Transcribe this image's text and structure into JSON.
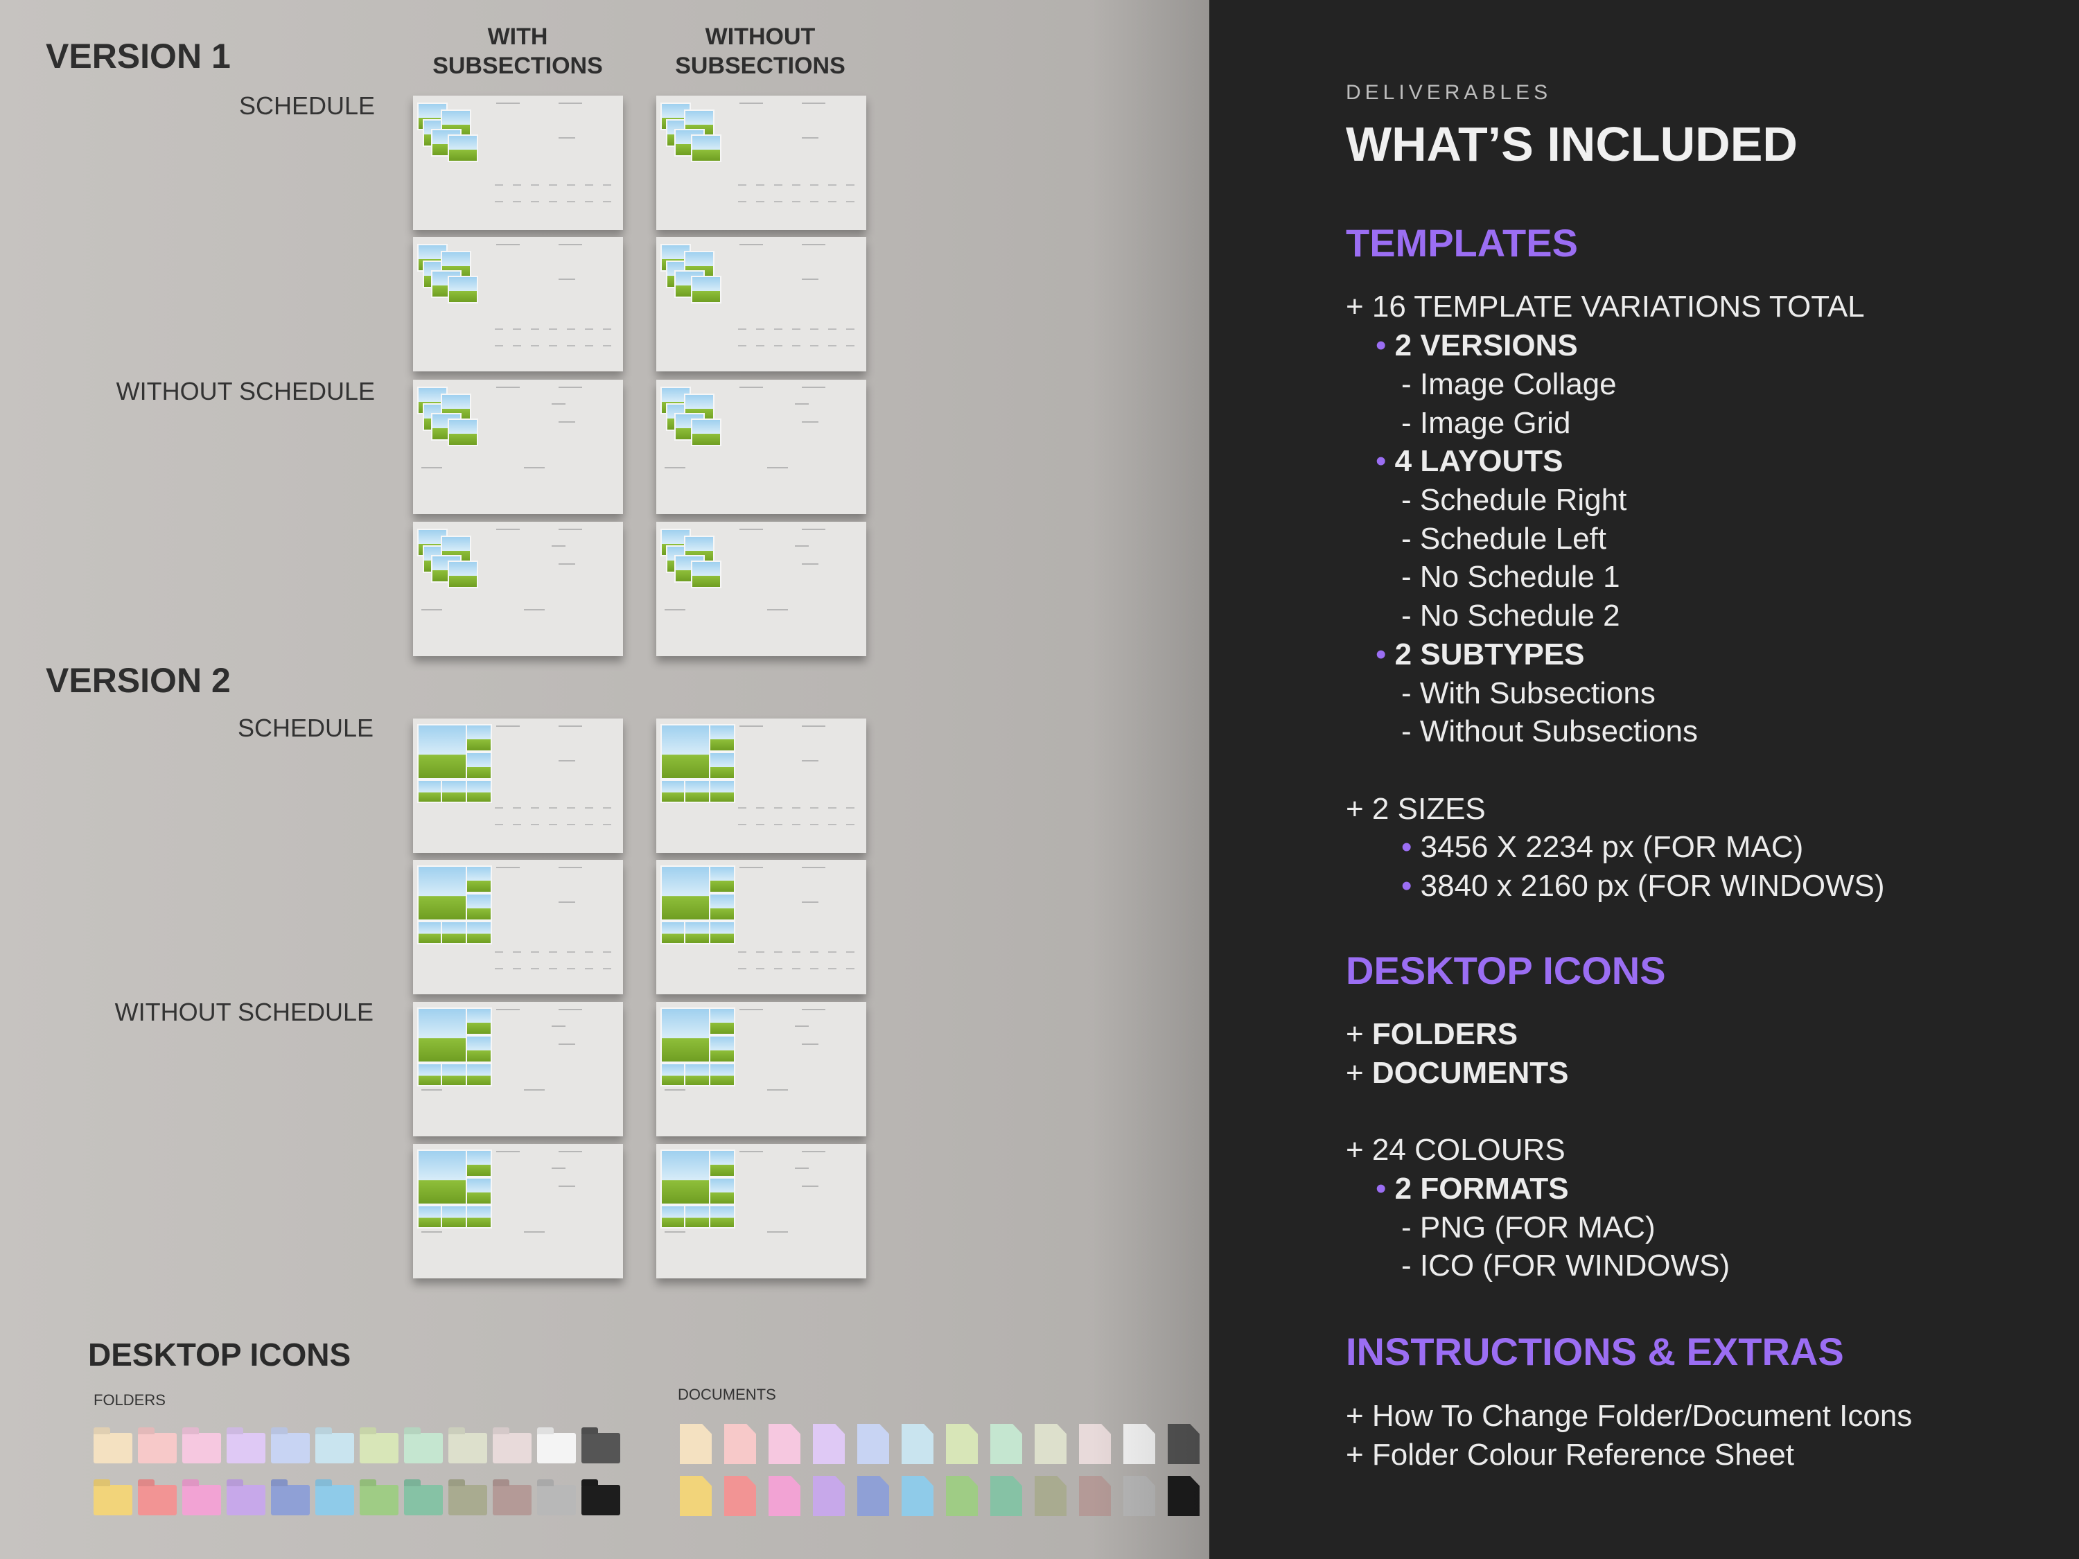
{
  "left": {
    "version1_title": "VERSION 1",
    "version2_title": "VERSION 2",
    "col_with": "WITH SUBSECTIONS",
    "col_without": "WITHOUT SUBSECTIONS",
    "row_schedule": "SCHEDULE",
    "row_without_schedule": "WITHOUT SCHEDULE",
    "icons_title": "DESKTOP ICONS",
    "folders_label": "FOLDERS",
    "documents_label": "DOCUMENTS",
    "icon_colors_light": [
      "#f4e1c1",
      "#f7c9c9",
      "#f6c8e0",
      "#dfc9f5",
      "#c8d4f3",
      "#c9e4ef",
      "#d8e6b8",
      "#c5e6d0",
      "#dde0cc",
      "#e8dada",
      "#f4f4f4",
      "#555555"
    ],
    "icon_colors_dark": [
      "#f2d47a",
      "#f29494",
      "#f2a3d4",
      "#c7a8ea",
      "#8fa0d6",
      "#8fcbe9",
      "#9fcc85",
      "#86c2a5",
      "#a9ab90",
      "#b49a97",
      "#b8b8b8",
      "#1d1d1d"
    ]
  },
  "right": {
    "eyebrow": "DELIVERABLES",
    "title": "WHAT’S INCLUDED",
    "templates_heading": "TEMPLATES",
    "templates_total": "16 TEMPLATE VARIATIONS TOTAL",
    "versions": "2 VERSIONS",
    "version_items": [
      "Image Collage",
      "Image Grid"
    ],
    "layouts": "4 LAYOUTS",
    "layout_items": [
      "Schedule Right",
      "Schedule Left",
      "No Schedule 1",
      "No Schedule 2"
    ],
    "subtypes": "2 SUBTYPES",
    "subtype_items": [
      "With Subsections",
      "Without Subsections"
    ],
    "sizes": "2 SIZES",
    "size_items": [
      "3456 X 2234 px (FOR MAC)",
      "3840 x 2160 px (FOR WINDOWS)"
    ],
    "icons_heading": "DESKTOP ICONS",
    "folders": "FOLDERS",
    "documents": "DOCUMENTS",
    "colours": "24 COLOURS",
    "formats": "2 FORMATS",
    "format_items": [
      "PNG (FOR MAC)",
      "ICO (FOR WINDOWS)"
    ],
    "extras_heading": "INSTRUCTIONS & EXTRAS",
    "extras_items": [
      "How To Change Folder/Document Icons",
      "Folder Colour Reference Sheet"
    ],
    "accent_color": "#9b6ef3"
  }
}
